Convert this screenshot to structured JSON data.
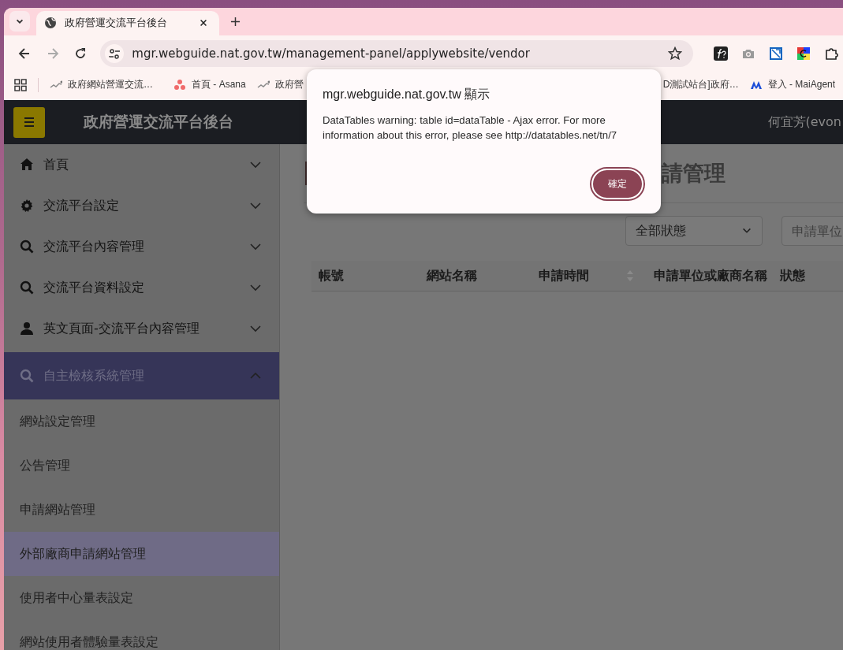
{
  "browser": {
    "tab": {
      "title": "政府營運交流平台後台",
      "selected": true
    },
    "nav_buttons": [
      {
        "kind": "back",
        "disabled": false
      },
      {
        "kind": "forward",
        "disabled": true
      },
      {
        "kind": "reload",
        "disabled": false
      }
    ],
    "address": {
      "url": "mgr.webguide.nat.gov.tw/management-panel/applywebsite/vendor"
    },
    "extensions": [
      {
        "kind": "function"
      },
      {
        "kind": "camera"
      },
      {
        "kind": "square"
      },
      {
        "kind": "color"
      },
      {
        "kind": "puzzle"
      }
    ],
    "bookmarks": [
      {
        "label": "政府網站營運交流…",
        "kind": "chart"
      },
      {
        "label": "首頁 - Asana",
        "kind": "dots"
      },
      {
        "label": "政府營",
        "kind": "chart"
      },
      {
        "label": "D測試站台]政府…",
        "kind": "none"
      },
      {
        "label": "登入 - MaiAgent",
        "kind": "agent"
      }
    ]
  },
  "header": {
    "title": "政府營運交流平台後台",
    "user": "何宜芳(evon"
  },
  "sidebar": {
    "items": [
      {
        "label": "首頁",
        "kind": "home",
        "expanded": false
      },
      {
        "label": "交流平台設定",
        "kind": "gear",
        "expanded": false
      },
      {
        "label": "交流平台內容管理",
        "kind": "search",
        "expanded": false
      },
      {
        "label": "交流平台資料設定",
        "kind": "search",
        "expanded": false
      },
      {
        "label": "英文頁面-交流平台內容管理",
        "kind": "person",
        "expanded": false
      },
      {
        "label": "自主檢核系統管理",
        "kind": "search",
        "expanded": true,
        "children": [
          {
            "label": "網站設定管理",
            "selected": false
          },
          {
            "label": "公告管理",
            "selected": false
          },
          {
            "label": "申請網站管理",
            "selected": false
          },
          {
            "label": "外部廠商申請網站管理",
            "selected": true
          },
          {
            "label": "使用者中心量表設定",
            "selected": false
          },
          {
            "label": "網站使用者體驗量表設定",
            "selected": false
          }
        ]
      }
    ]
  },
  "content": {
    "heading": "請管理",
    "filters": {
      "status": {
        "value": "全部狀態"
      },
      "search": {
        "placeholder": "申請單位"
      }
    },
    "table": {
      "columns": [
        {
          "label": "帳號",
          "kind": "plain"
        },
        {
          "label": "網站名稱",
          "kind": "plain"
        },
        {
          "label": "申請時間",
          "kind": "sortable"
        },
        {
          "label": "申請單位或廠商名稱",
          "kind": "plain"
        },
        {
          "label": "狀態",
          "kind": "plain"
        }
      ]
    }
  },
  "dialog": {
    "title": "mgr.webguide.nat.gov.tw 顯示",
    "message": "DataTables warning: table id=dataTable - Ajax error. For more information about this error, please see http://datatables.net/tn/7",
    "button": "確定"
  }
}
